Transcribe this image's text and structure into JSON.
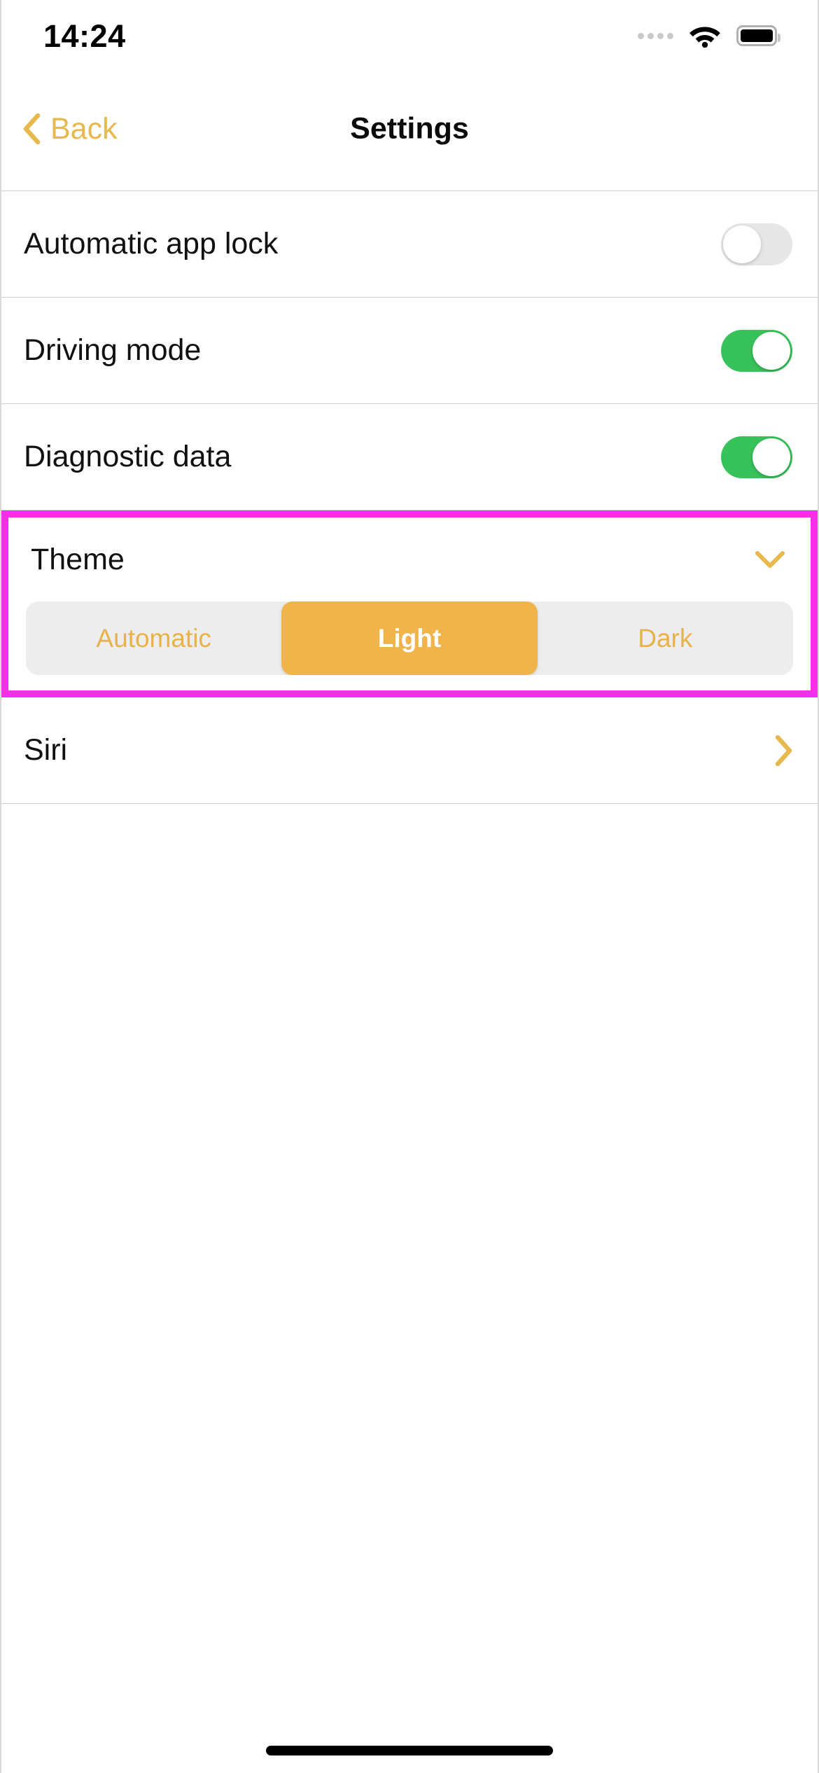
{
  "status_bar": {
    "time": "14:24",
    "signal_icon": "signal-dots-icon",
    "wifi_icon": "wifi-icon",
    "battery_icon": "battery-full-icon"
  },
  "nav_bar": {
    "back_label": "Back",
    "back_icon": "chevron-left-icon",
    "title": "Settings"
  },
  "settings_rows": [
    {
      "label": "Automatic app lock",
      "control": "toggle",
      "state": "off"
    },
    {
      "label": "Driving mode",
      "control": "toggle",
      "state": "on"
    },
    {
      "label": "Diagnostic data",
      "control": "toggle",
      "state": "on"
    }
  ],
  "theme_section": {
    "label": "Theme",
    "expand_icon": "chevron-down-icon",
    "highlighted": true,
    "highlight_color": "#F92EEA",
    "options": [
      {
        "label": "Automatic",
        "selected": false
      },
      {
        "label": "Light",
        "selected": true
      },
      {
        "label": "Dark",
        "selected": false
      }
    ]
  },
  "siri_row": {
    "label": "Siri",
    "disclosure_icon": "chevron-right-icon"
  },
  "colors": {
    "accent": "#E6B84E",
    "toggle_on": "#38C25B",
    "toggle_off": "#E6E6E6",
    "segment_track": "#EDEDED",
    "segment_selected": "#F0B44A",
    "highlight": "#F92EEA",
    "divider": "#CFCFCF"
  },
  "home_indicator": "home-indicator"
}
